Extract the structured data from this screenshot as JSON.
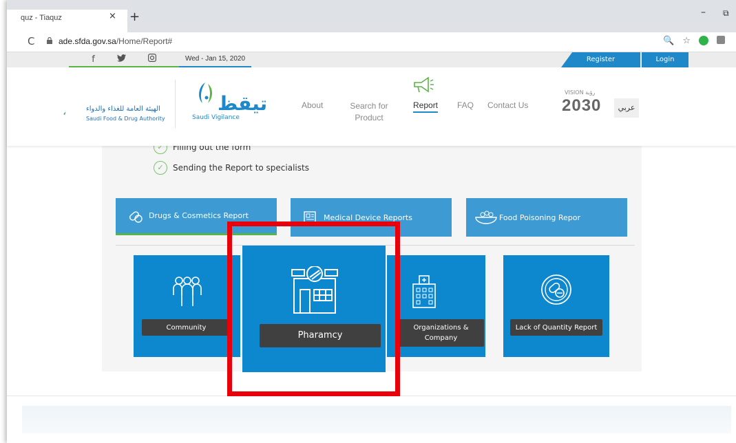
{
  "browser": {
    "tab_title": "quz - Tiaquz",
    "tab_close": "×",
    "new_tab": "+",
    "url_domain": "ade.sfda.gov.sa",
    "url_path": "/Home/Report#"
  },
  "topbar": {
    "social": [
      "f",
      "🐦",
      "◎"
    ],
    "date": "Wed - Jan 15, 2020",
    "register": "Register",
    "login": "Login"
  },
  "header": {
    "sfda_ar": "الهيئة العامة للغذاء والدواء",
    "sfda_en": "Saudi Food & Drug Authority",
    "brand_ar": "تيقظ",
    "brand_en": "Saudi Vigilance",
    "nav": [
      {
        "label": "About"
      },
      {
        "label": "Search for Product"
      },
      {
        "label": "Report"
      },
      {
        "label": "FAQ"
      },
      {
        "label": "Contact Us"
      }
    ],
    "vision_label": "VISION رؤية",
    "vision_year": "2030",
    "arabic_toggle": "عربي"
  },
  "steps": [
    "Filling out the form",
    "Sending the Report to specialists"
  ],
  "report_tabs": [
    {
      "label": "Drugs & Cosmetics Report"
    },
    {
      "label": "Medical Device Reports"
    },
    {
      "label": "Food Poisoning Repor"
    }
  ],
  "cards": [
    {
      "label": "Community"
    },
    {
      "label": "Pharamcy"
    },
    {
      "label": "Organizations & Company"
    },
    {
      "label": "Lack of Quantity Report"
    }
  ],
  "colors": {
    "accent_blue": "#0d88ce",
    "tab_blue": "#3d9ad2",
    "green": "#5ab346",
    "highlight_red": "#e8000b"
  }
}
